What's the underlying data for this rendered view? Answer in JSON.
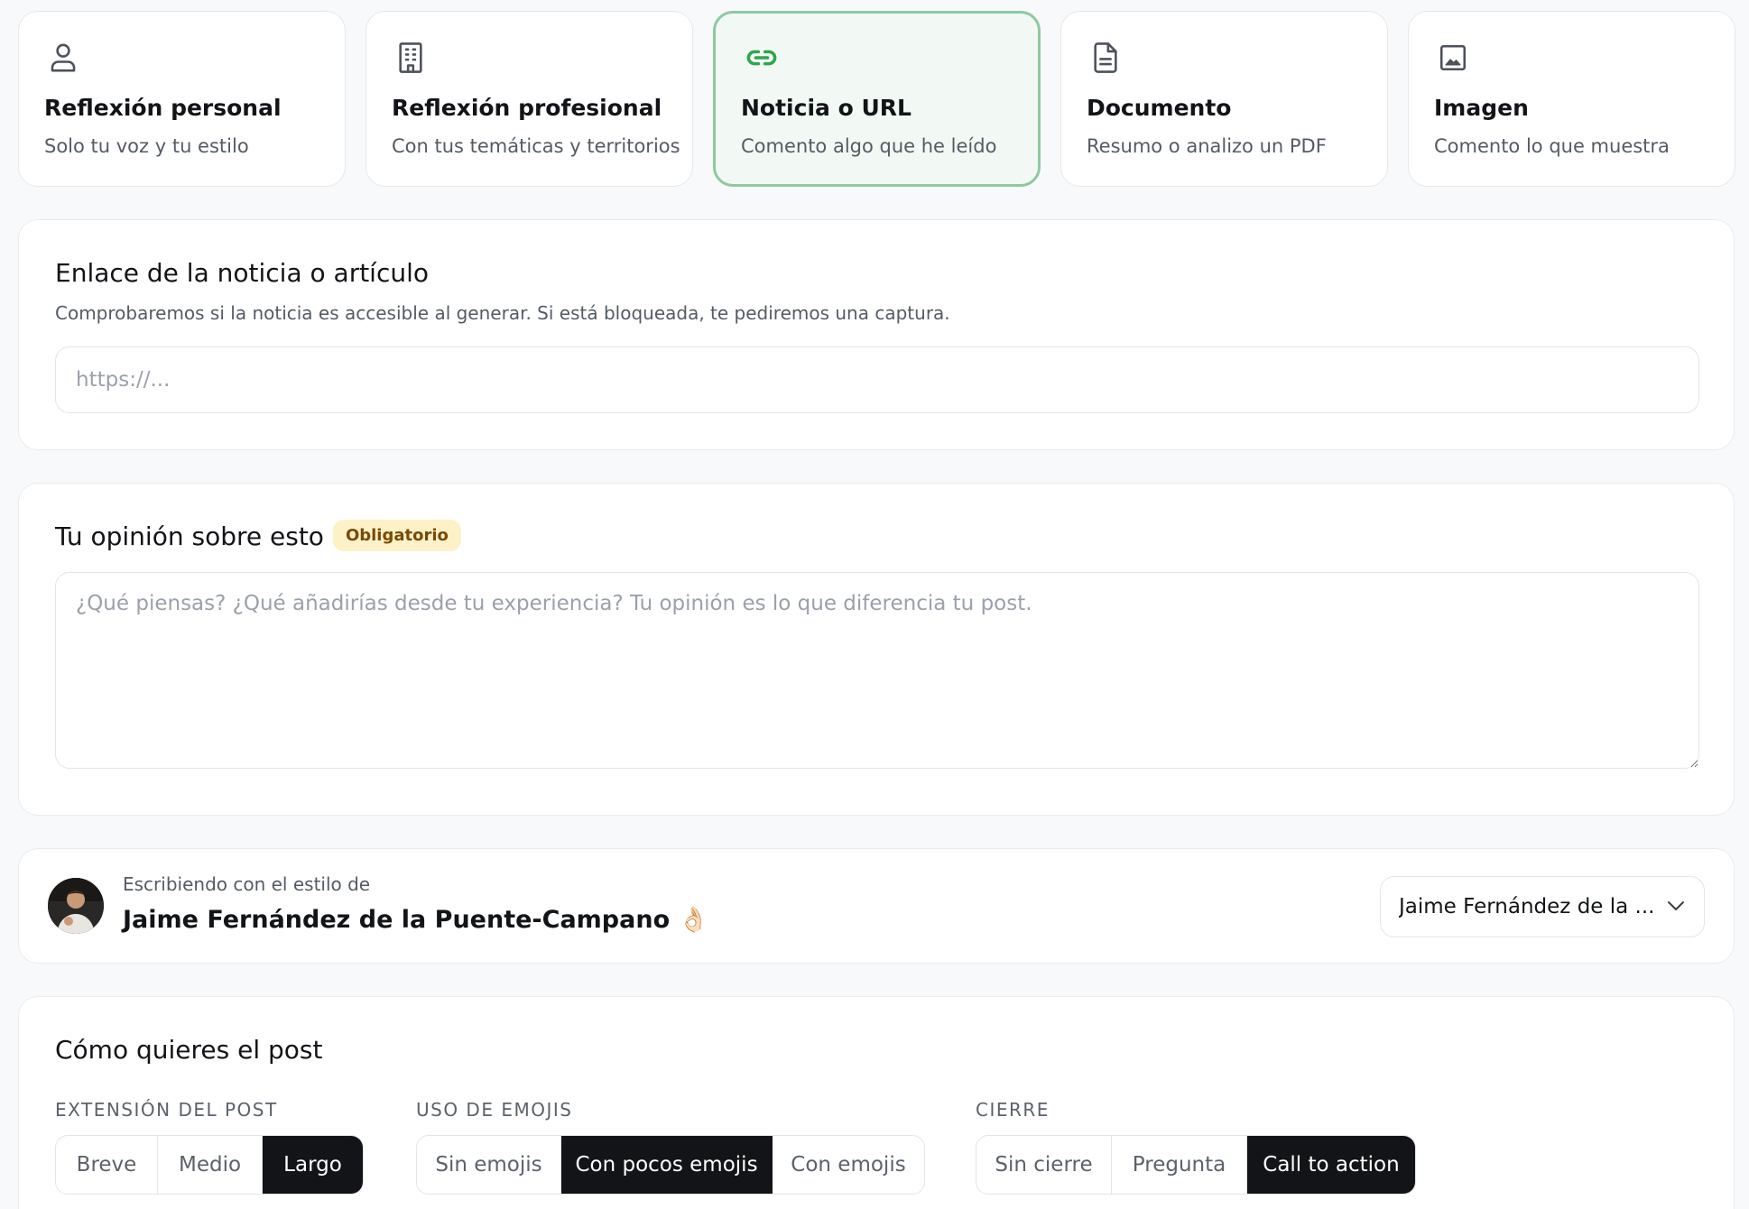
{
  "modes": [
    {
      "title": "Reflexión personal",
      "subtitle": "Solo tu voz y tu estilo",
      "icon": "user-icon",
      "selected": false
    },
    {
      "title": "Reflexión profesional",
      "subtitle": "Con tus temáticas y territorios",
      "icon": "building-icon",
      "selected": false
    },
    {
      "title": "Noticia o URL",
      "subtitle": "Comento algo que he leído",
      "icon": "link-icon",
      "selected": true
    },
    {
      "title": "Documento",
      "subtitle": "Resumo o analizo un PDF",
      "icon": "document-icon",
      "selected": false
    },
    {
      "title": "Imagen",
      "subtitle": "Comento lo que muestra",
      "icon": "image-icon",
      "selected": false
    }
  ],
  "url_section": {
    "title": "Enlace de la noticia o artículo",
    "description": "Comprobaremos si la noticia es accesible al generar. Si está bloqueada, te pediremos una captura.",
    "placeholder": "https://...",
    "value": ""
  },
  "opinion_section": {
    "title": "Tu opinión sobre esto",
    "badge": "Obligatorio",
    "placeholder": "¿Qué piensas? ¿Qué añadirías desde tu experiencia? Tu opinión es lo que diferencia tu post.",
    "value": ""
  },
  "author": {
    "caption": "Escribiendo con el estilo de",
    "name": "Jaime Fernández de la Puente-Campano 👌🏻",
    "select_value": "Jaime Fernández de la ..."
  },
  "post_options": {
    "title": "Cómo quieres el post",
    "groups": [
      {
        "label": "EXTENSIÓN DEL POST",
        "options": [
          "Breve",
          "Medio",
          "Largo"
        ],
        "selected": "Largo"
      },
      {
        "label": "USO DE EMOJIS",
        "options": [
          "Sin emojis",
          "Con pocos emojis",
          "Con emojis"
        ],
        "selected": "Con pocos emojis"
      },
      {
        "label": "CIERRE",
        "options": [
          "Sin cierre",
          "Pregunta",
          "Call to action"
        ],
        "selected": "Call to action"
      }
    ]
  },
  "colors": {
    "accent_green": "#2fa64f",
    "selected_border": "#8ec9a0",
    "badge_bg": "#fdf1c8",
    "badge_text": "#7a4a05",
    "segment_active": "#131417"
  }
}
